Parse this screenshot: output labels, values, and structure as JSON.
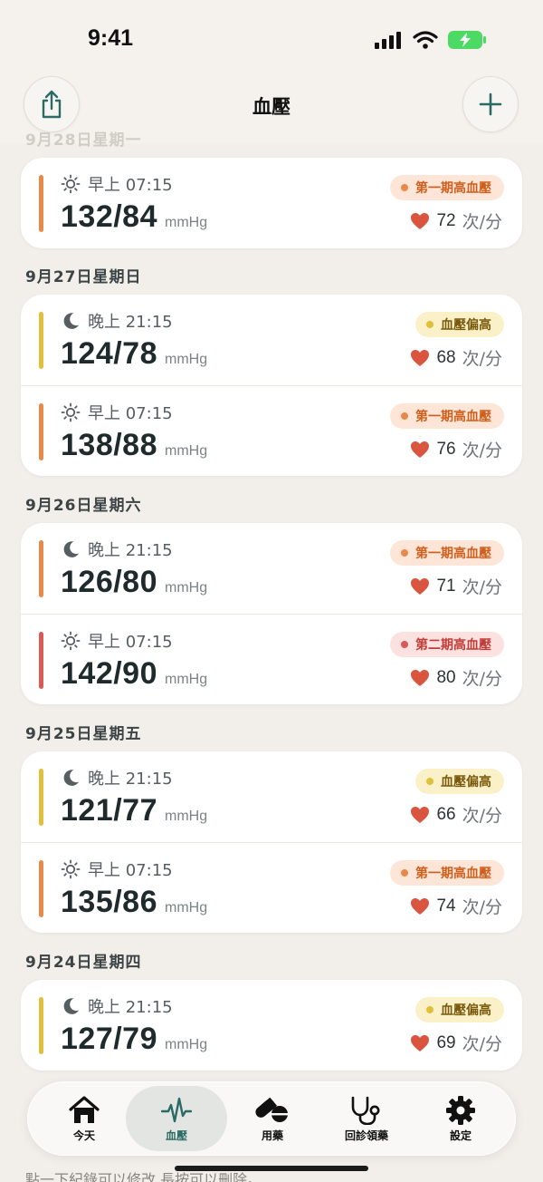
{
  "status_bar": {
    "time": "9:41"
  },
  "nav": {
    "title": "血壓"
  },
  "ghost_date": "9月28日星期一",
  "colors": {
    "orange": "#e8894a",
    "yellow": "#e0bf3a",
    "red": "#db5a55",
    "teal": "#2b6b66",
    "heart": "#d9553f"
  },
  "unit": "mmHg",
  "pulse_unit": "次/分",
  "entries": [
    {
      "label": "早上 07:15",
      "icon": "sun-icon",
      "bp": "132/84",
      "pulse": "72",
      "badge": "第一期高血壓",
      "level": "orange"
    }
  ],
  "groups": [
    {
      "date": "9月27日星期日",
      "readings": [
        {
          "label": "晚上 21:15",
          "icon": "moon-icon",
          "bp": "124/78",
          "pulse": "68",
          "badge": "血壓偏高",
          "level": "yellow"
        },
        {
          "label": "早上 07:15",
          "icon": "sun-icon",
          "bp": "138/88",
          "pulse": "76",
          "badge": "第一期高血壓",
          "level": "orange"
        }
      ]
    },
    {
      "date": "9月26日星期六",
      "readings": [
        {
          "label": "晚上 21:15",
          "icon": "moon-icon",
          "bp": "126/80",
          "pulse": "71",
          "badge": "第一期高血壓",
          "level": "orange"
        },
        {
          "label": "早上 07:15",
          "icon": "sun-icon",
          "bp": "142/90",
          "pulse": "80",
          "badge": "第二期高血壓",
          "level": "red"
        }
      ]
    },
    {
      "date": "9月25日星期五",
      "readings": [
        {
          "label": "晚上 21:15",
          "icon": "moon-icon",
          "bp": "121/77",
          "pulse": "66",
          "badge": "血壓偏高",
          "level": "yellow"
        },
        {
          "label": "早上 07:15",
          "icon": "sun-icon",
          "bp": "135/86",
          "pulse": "74",
          "badge": "第一期高血壓",
          "level": "orange"
        }
      ]
    },
    {
      "date": "9月24日星期四",
      "readings": [
        {
          "label": "晚上 21:15",
          "icon": "moon-icon",
          "bp": "127/79",
          "pulse": "69",
          "badge": "血壓偏高",
          "level": "yellow"
        }
      ]
    }
  ],
  "tabs": [
    {
      "label": "今天",
      "icon": "home-icon",
      "active": false
    },
    {
      "label": "血壓",
      "icon": "pulse-wave-icon",
      "active": true
    },
    {
      "label": "用藥",
      "icon": "pills-icon",
      "active": false
    },
    {
      "label": "回診領藥",
      "icon": "stethoscope-icon",
      "active": false
    },
    {
      "label": "設定",
      "icon": "gear-icon",
      "active": false
    }
  ],
  "hint": "點一下紀錄可以修改,長按可以刪除。"
}
